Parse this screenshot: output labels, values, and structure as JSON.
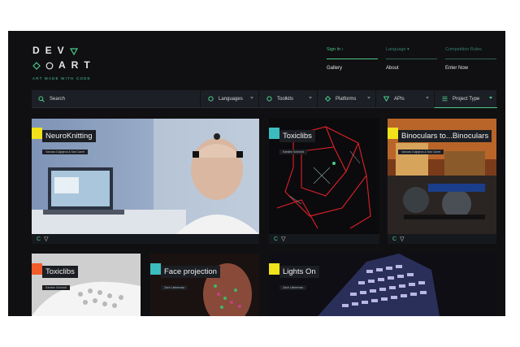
{
  "logo": {
    "line1": "DEV",
    "line2": "ART",
    "tagline": "ART MADE WITH CODE"
  },
  "topnav": [
    {
      "top": "Sign In ›",
      "bottom": "Gallery",
      "active": true
    },
    {
      "top": "Language ▾",
      "bottom": "About",
      "active": false
    },
    {
      "top": "Competition Rules",
      "bottom": "Enter Now",
      "active": false
    }
  ],
  "filters": {
    "search": "Search",
    "languages": "Languages",
    "toolkits": "Toolkits",
    "platforms": "Platforms",
    "apis": "APIs",
    "project_type": "Project Type"
  },
  "colors": {
    "accent": "#4cc98a",
    "yellow": "#f1e21b",
    "teal": "#3cbcbf",
    "orange": "#f25c2a"
  },
  "cards": [
    {
      "title": "NeuroKnitting",
      "author": "Varvara Guljajeva & Mar Canet",
      "swatch": "#f1e21b"
    },
    {
      "title": "Toxiclibs",
      "author": "Karsten Schmidt",
      "swatch": "#3cbcbf"
    },
    {
      "title": "Binoculars to...Binoculars",
      "author": "Varvara Guljajeva & Mar Canet",
      "swatch": "#f1e21b"
    },
    {
      "title": "Toxiclibs",
      "author": "Karsten Schmidt",
      "swatch": "#f25c2a"
    },
    {
      "title": "Face projection",
      "author": "Zach Lieberman",
      "swatch": "#3cbcbf"
    },
    {
      "title": "Lights On",
      "author": "Zach Lieberman",
      "swatch": "#f1e21b"
    }
  ],
  "card_footer_icons": [
    "c-icon",
    "triangle-icon"
  ],
  "footer_glyphs": {
    "c": "C",
    "v": "▽"
  }
}
